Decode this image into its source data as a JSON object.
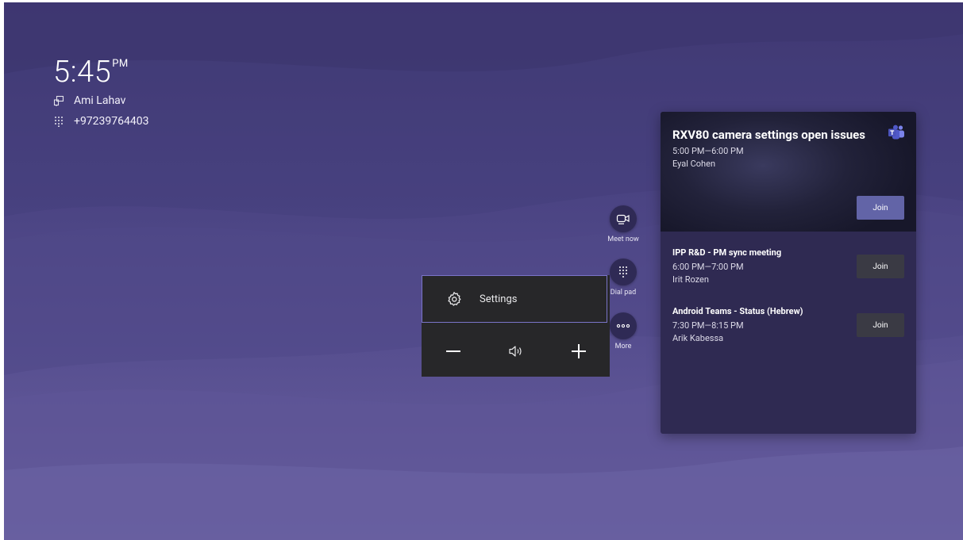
{
  "clock": {
    "time": "5:45",
    "ampm": "PM"
  },
  "identity": {
    "name": "Ami Lahav",
    "phone": "+97239764403"
  },
  "actions": [
    {
      "label": "Meet now",
      "icon": "video-camera-icon"
    },
    {
      "label": "Dial pad",
      "icon": "dial-pad-icon"
    },
    {
      "label": "More",
      "icon": "more-icon"
    }
  ],
  "menu": {
    "settings_label": "Settings"
  },
  "meetings": [
    {
      "title": "RXV80 camera settings open issues",
      "time": "5:00 PM—6:00 PM",
      "organizer": "Eyal Cohen",
      "join_label": "Join"
    },
    {
      "title": "IPP R&D - PM sync meeting",
      "time": "6:00 PM—7:00 PM",
      "organizer": "Irit Rozen",
      "join_label": "Join"
    },
    {
      "title": "Android Teams - Status (Hebrew)",
      "time": "7:30 PM—8:15 PM",
      "organizer": "Arik Kabessa",
      "join_label": "Join"
    }
  ],
  "colors": {
    "accent": "#6264a7",
    "panel": "#2f2a52",
    "menu": "#272729",
    "focus": "#7a74c8"
  }
}
